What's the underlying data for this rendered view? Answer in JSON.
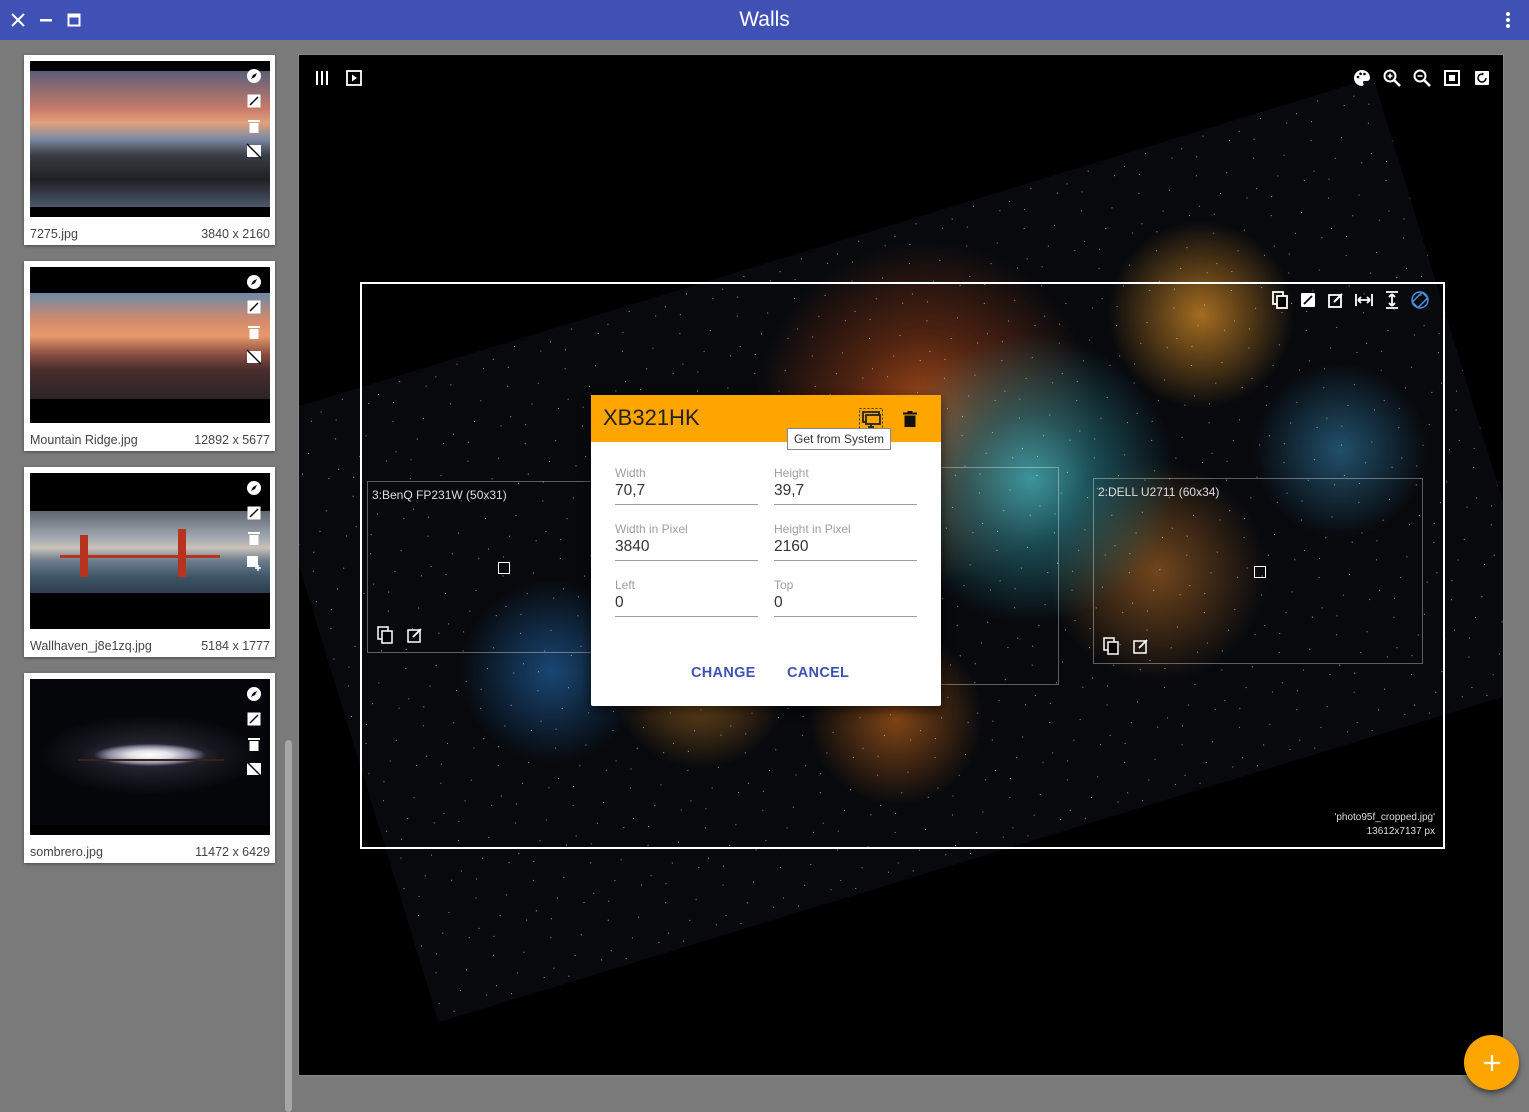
{
  "window": {
    "title": "Walls"
  },
  "wallpapers": [
    {
      "name": "7275.jpg",
      "size": "3840 x 2160"
    },
    {
      "name": "Mountain Ridge.jpg",
      "size": "12892 x 5677"
    },
    {
      "name": "Wallhaven_j8e1zq.jpg",
      "size": "5184 x 1777"
    },
    {
      "name": "sombrero.jpg",
      "size": "11472 x 6429"
    }
  ],
  "canvas": {
    "image_info_name": "'photo95f_cropped.jpg'",
    "image_info_size": "13612x7137 px"
  },
  "monitors": [
    {
      "label": "3:BenQ FP231W (50x31)"
    },
    {
      "label": "2:DELL U2711 (60x34)"
    }
  ],
  "dialog": {
    "title": "XB321HK",
    "tooltip": "Get from System",
    "fields": {
      "width": {
        "label": "Width",
        "value": "70,7"
      },
      "height": {
        "label": "Height",
        "value": "39,7"
      },
      "width_px": {
        "label": "Width in Pixel",
        "value": "3840"
      },
      "height_px": {
        "label": "Height in Pixel",
        "value": "2160"
      },
      "left": {
        "label": "Left",
        "value": "0"
      },
      "top": {
        "label": "Top",
        "value": "0"
      }
    },
    "change_label": "CHANGE",
    "cancel_label": "CANCEL"
  },
  "colors": {
    "titlebar": "#3f51b5",
    "accent": "#ffa500",
    "button_text": "#3f51b5"
  }
}
